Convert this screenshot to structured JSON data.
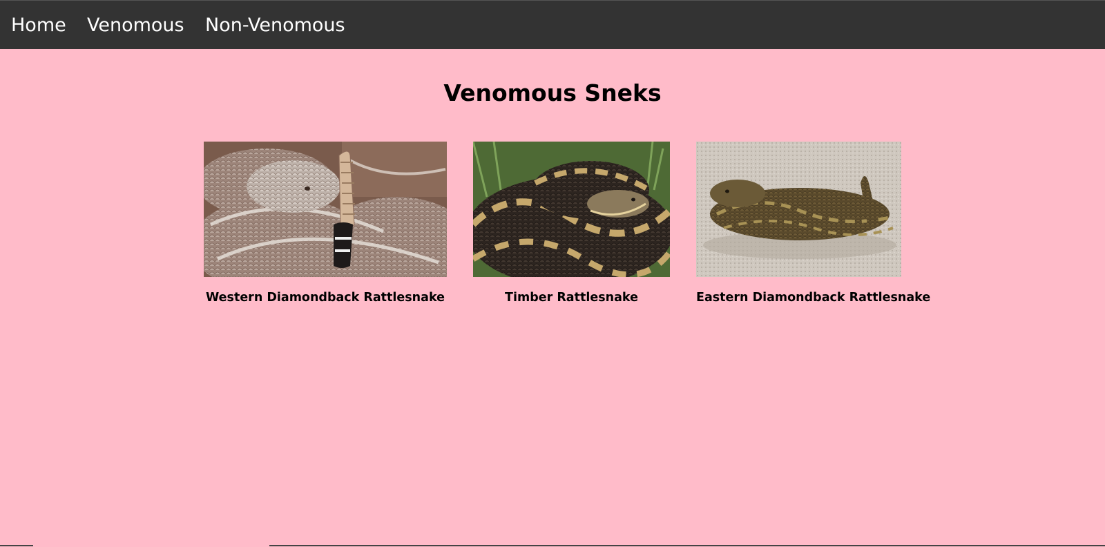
{
  "nav": {
    "items": [
      {
        "label": "Home"
      },
      {
        "label": "Venomous"
      },
      {
        "label": "Non-Venomous"
      }
    ],
    "background": "#333333",
    "text_color": "#ffffff"
  },
  "page": {
    "title": "Venomous Sneks",
    "background": "#ffbbc9"
  },
  "cards": [
    {
      "caption": "Western Diamondback Rattlesnake",
      "image": "western-diamondback-rattlesnake-photo"
    },
    {
      "caption": "Timber Rattlesnake",
      "image": "timber-rattlesnake-photo"
    },
    {
      "caption": "Eastern Diamondback Rattlesnake",
      "image": "eastern-diamondback-rattlesnake-photo"
    }
  ]
}
